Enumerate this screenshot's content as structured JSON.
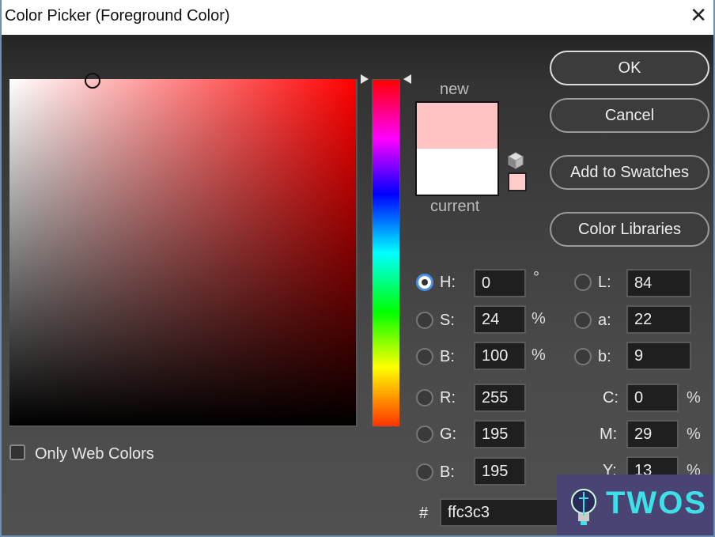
{
  "window": {
    "title": "Color Picker (Foreground Color)",
    "close_icon": "close-x-icon"
  },
  "picker": {
    "hue_degrees": 0,
    "field_cursor": {
      "saturation_percent": 24,
      "brightness_percent": 100
    },
    "hue_slider_value_degrees": 0
  },
  "swatches": {
    "new_label": "new",
    "current_label": "current",
    "new_color": "#ffc3c3",
    "current_color": "#ffffff",
    "gamut_icon": "cube-icon",
    "web_safe_color": "#ffcccc"
  },
  "buttons": {
    "ok": "OK",
    "cancel": "Cancel",
    "add_to_swatches": "Add to Swatches",
    "color_libraries": "Color Libraries"
  },
  "hsb": {
    "h": {
      "label": "H:",
      "value": "0",
      "unit": "°",
      "selected": true
    },
    "s": {
      "label": "S:",
      "value": "24",
      "unit": "%",
      "selected": false
    },
    "b": {
      "label": "B:",
      "value": "100",
      "unit": "%",
      "selected": false
    }
  },
  "lab": {
    "l": {
      "label": "L:",
      "value": "84",
      "selected": false
    },
    "a": {
      "label": "a:",
      "value": "22",
      "selected": false
    },
    "b": {
      "label": "b:",
      "value": "9",
      "selected": false
    }
  },
  "rgb": {
    "r": {
      "label": "R:",
      "value": "255",
      "selected": false
    },
    "g": {
      "label": "G:",
      "value": "195",
      "selected": false
    },
    "b": {
      "label": "B:",
      "value": "195",
      "selected": false
    }
  },
  "cmyk": {
    "c": {
      "label": "C:",
      "value": "0",
      "unit": "%"
    },
    "m": {
      "label": "M:",
      "value": "29",
      "unit": "%"
    },
    "y": {
      "label": "Y:",
      "value": "13",
      "unit": "%"
    }
  },
  "hex": {
    "label": "#",
    "value": "ffc3c3"
  },
  "only_web_colors": {
    "label": "Only Web Colors",
    "checked": false
  },
  "watermark": {
    "text": "TWOS"
  }
}
